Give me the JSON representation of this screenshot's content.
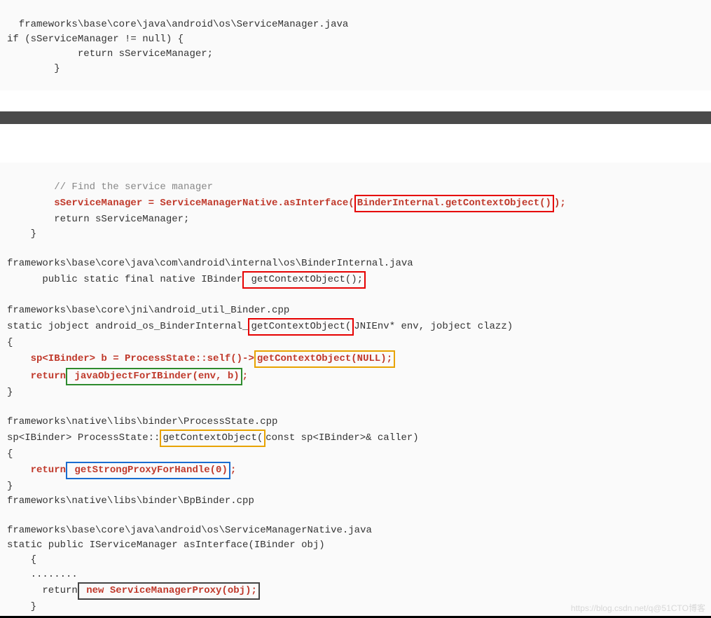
{
  "block1": {
    "l1": "  frameworks\\base\\core\\java\\android\\os\\ServiceManager.java",
    "l2": "if (sServiceManager != null) {",
    "l3": "            return sServiceManager;",
    "l4": "        }"
  },
  "block2": {
    "l1": "        // Find the service manager",
    "l2a": "        sServiceManager = ServiceManagerNative.asInterface(",
    "l2b": "BinderInternal.getContextObject()",
    "l2c": ");",
    "l3": "        return sServiceManager;",
    "l4": "    }",
    "l5": "frameworks\\base\\core\\java\\com\\android\\internal\\os\\BinderInternal.java",
    "l6a": "      public static final native IBinder",
    "l6b": " getContextObject();",
    "l7": "frameworks\\base\\core\\jni\\android_util_Binder.cpp",
    "l8a": "static jobject android_os_BinderInternal_",
    "l8b": "getContextObject(",
    "l8c": "JNIEnv* env, jobject clazz)",
    "l9": "{",
    "l10a": "    sp<IBinder> b = ProcessState::self()->",
    "l10b": "getContextObject(NULL);",
    "l11a": "    return",
    "l11b": " javaObjectForIBinder(env, b)",
    "l11c": ";",
    "l12": "}",
    "l13": "frameworks\\native\\libs\\binder\\ProcessState.cpp",
    "l14a": "sp<IBinder> ProcessState::",
    "l14b": "getContextObject(",
    "l14c": "const sp<IBinder>& caller)",
    "l15": "{",
    "l16a": "    return",
    "l16b": " getStrongProxyForHandle(0)",
    "l16c": ";",
    "l17": "}",
    "l18": "frameworks\\native\\libs\\binder\\BpBinder.cpp",
    "l19": "frameworks\\base\\core\\java\\android\\os\\ServiceManagerNative.java",
    "l20": "static public IServiceManager asInterface(IBinder obj)",
    "l21": "    {",
    "l22": "    ........",
    "l23a": "      return",
    "l23b": " new ServiceManagerProxy(obj);",
    "l24": "    }"
  },
  "watermark_left": "https://blog.csdn.net/q",
  "watermark_right": "@51CTO博客"
}
